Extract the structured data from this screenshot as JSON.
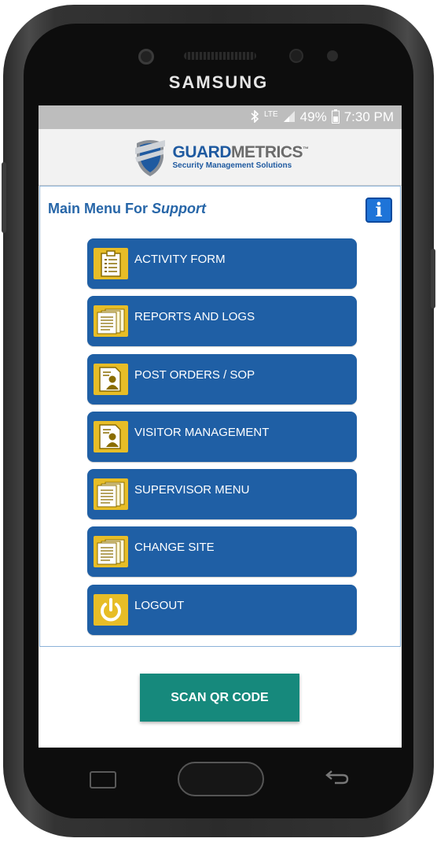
{
  "device": {
    "brand": "SAMSUNG"
  },
  "status_bar": {
    "network": "LTE",
    "battery": "49%",
    "time": "7:30 PM",
    "icons": [
      "bluetooth-icon",
      "signal-icon",
      "battery-icon"
    ]
  },
  "logo": {
    "name_part1": "GUARD",
    "name_part2": "METRICS",
    "trademark": "™",
    "tagline": "Security Management Solutions"
  },
  "main_menu": {
    "title_prefix": "Main Menu For ",
    "title_user": "Support",
    "info_label": "i",
    "items": [
      {
        "label": "ACTIVITY FORM",
        "icon": "clipboard-icon"
      },
      {
        "label": "REPORTS AND LOGS",
        "icon": "documents-icon"
      },
      {
        "label": "POST ORDERS / SOP",
        "icon": "person-document-icon"
      },
      {
        "label": "VISITOR MANAGEMENT",
        "icon": "person-document-icon"
      },
      {
        "label": "SUPERVISOR MENU",
        "icon": "documents-icon"
      },
      {
        "label": "CHANGE SITE",
        "icon": "documents-icon"
      },
      {
        "label": "LOGOUT",
        "icon": "power-icon"
      }
    ]
  },
  "scan_button": {
    "label": "SCAN QR CODE"
  },
  "colors": {
    "menu_button": "#1f5fa5",
    "menu_icon_bg": "#e7bd27",
    "scan_button": "#16897c",
    "title_text": "#2766a8"
  }
}
